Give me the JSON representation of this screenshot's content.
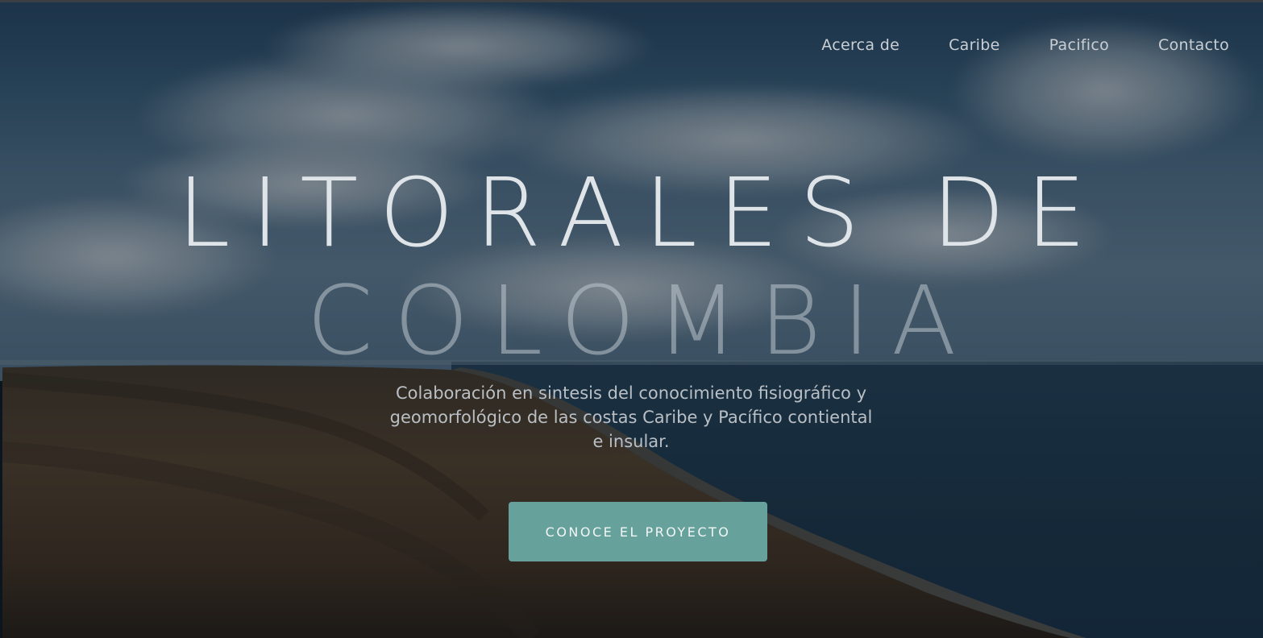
{
  "nav": {
    "items": [
      {
        "label": "Acerca de"
      },
      {
        "label": "Caribe"
      },
      {
        "label": "Pacifico"
      },
      {
        "label": "Contacto"
      }
    ]
  },
  "hero": {
    "title_line1": "LITORALES DE",
    "title_line2": "COLOMBIA",
    "subtitle": "Colaboración en sintesis del conocimiento fisiográfico y geomorfológico de las costas Caribe y Pacífico contiental e insular.",
    "cta_label": "CONOCE EL PROYECTO"
  },
  "colors": {
    "accent": "#66a19c",
    "nav_text": "#c9cfd4",
    "title_text": "#dfe4e8"
  }
}
